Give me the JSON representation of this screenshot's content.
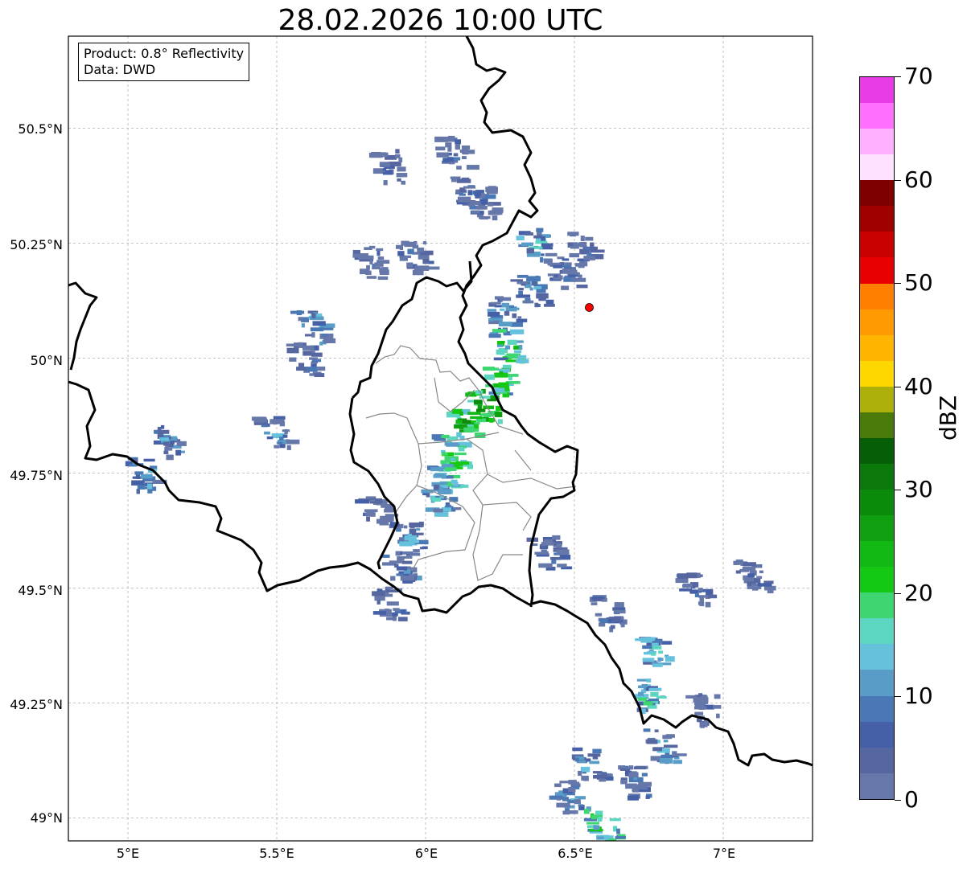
{
  "title": "28.02.2026 10:00 UTC",
  "info_box": {
    "product": "Product: 0.8° Reflectivity",
    "data": "Data: DWD"
  },
  "map": {
    "lon_range": [
      4.8,
      7.3
    ],
    "lat_range": [
      48.95,
      50.7
    ],
    "lon_ticks": [
      {
        "value": 5.0,
        "label": "5°E"
      },
      {
        "value": 5.5,
        "label": "5.5°E"
      },
      {
        "value": 6.0,
        "label": "6°E"
      },
      {
        "value": 6.5,
        "label": "6.5°E"
      },
      {
        "value": 7.0,
        "label": "7°E"
      }
    ],
    "lat_ticks": [
      {
        "value": 50.5,
        "label": "50.5°N"
      },
      {
        "value": 50.25,
        "label": "50.25°N"
      },
      {
        "value": 50.0,
        "label": "50°N"
      },
      {
        "value": 49.75,
        "label": "49.75°N"
      },
      {
        "value": 49.5,
        "label": "49.5°N"
      },
      {
        "value": 49.25,
        "label": "49.25°N"
      },
      {
        "value": 49.0,
        "label": "49°N"
      }
    ],
    "grid": true,
    "radar_site": {
      "lon": 6.55,
      "lat": 50.11,
      "color": "#ff0000"
    },
    "echo_cells": [
      {
        "lon": 6.1,
        "lat": 50.45,
        "dbz": 8
      },
      {
        "lon": 6.15,
        "lat": 50.36,
        "dbz": 9
      },
      {
        "lon": 5.82,
        "lat": 50.21,
        "dbz": 7
      },
      {
        "lon": 5.97,
        "lat": 50.22,
        "dbz": 7
      },
      {
        "lon": 5.88,
        "lat": 50.42,
        "dbz": 6
      },
      {
        "lon": 6.2,
        "lat": 50.34,
        "dbz": 8
      },
      {
        "lon": 5.63,
        "lat": 50.07,
        "dbz": 14
      },
      {
        "lon": 5.6,
        "lat": 50.0,
        "dbz": 9
      },
      {
        "lon": 5.5,
        "lat": 49.84,
        "dbz": 10
      },
      {
        "lon": 5.14,
        "lat": 49.82,
        "dbz": 11
      },
      {
        "lon": 5.06,
        "lat": 49.75,
        "dbz": 13
      },
      {
        "lon": 6.37,
        "lat": 50.25,
        "dbz": 15
      },
      {
        "lon": 6.36,
        "lat": 50.15,
        "dbz": 14
      },
      {
        "lon": 6.27,
        "lat": 50.1,
        "dbz": 13
      },
      {
        "lon": 6.28,
        "lat": 50.03,
        "dbz": 22
      },
      {
        "lon": 6.25,
        "lat": 49.96,
        "dbz": 24
      },
      {
        "lon": 6.2,
        "lat": 49.9,
        "dbz": 28
      },
      {
        "lon": 6.14,
        "lat": 49.86,
        "dbz": 26
      },
      {
        "lon": 6.1,
        "lat": 49.8,
        "dbz": 23
      },
      {
        "lon": 6.08,
        "lat": 49.74,
        "dbz": 20
      },
      {
        "lon": 6.05,
        "lat": 49.7,
        "dbz": 15
      },
      {
        "lon": 5.96,
        "lat": 49.61,
        "dbz": 12
      },
      {
        "lon": 5.92,
        "lat": 49.55,
        "dbz": 11
      },
      {
        "lon": 5.88,
        "lat": 49.47,
        "dbz": 9
      },
      {
        "lon": 5.84,
        "lat": 49.67,
        "dbz": 8
      },
      {
        "lon": 6.47,
        "lat": 50.19,
        "dbz": 8
      },
      {
        "lon": 6.53,
        "lat": 50.24,
        "dbz": 7
      },
      {
        "lon": 6.42,
        "lat": 49.58,
        "dbz": 9
      },
      {
        "lon": 6.62,
        "lat": 49.45,
        "dbz": 8
      },
      {
        "lon": 6.91,
        "lat": 49.5,
        "dbz": 7
      },
      {
        "lon": 7.1,
        "lat": 49.53,
        "dbz": 6
      },
      {
        "lon": 6.78,
        "lat": 49.36,
        "dbz": 16
      },
      {
        "lon": 6.75,
        "lat": 49.27,
        "dbz": 18
      },
      {
        "lon": 6.8,
        "lat": 49.16,
        "dbz": 13
      },
      {
        "lon": 6.55,
        "lat": 49.12,
        "dbz": 14
      },
      {
        "lon": 6.48,
        "lat": 49.05,
        "dbz": 12
      },
      {
        "lon": 6.6,
        "lat": 48.99,
        "dbz": 22
      },
      {
        "lon": 6.7,
        "lat": 49.08,
        "dbz": 11
      },
      {
        "lon": 6.95,
        "lat": 49.24,
        "dbz": 6
      }
    ]
  },
  "colorbar": {
    "label": "dBZ",
    "min": 0,
    "max": 70,
    "ticks": [
      "0",
      "10",
      "20",
      "30",
      "40",
      "50",
      "60",
      "70"
    ],
    "colors": [
      "#6677aa",
      "#5566a0",
      "#4560a6",
      "#4a78b4",
      "#5a9cc8",
      "#66c2dc",
      "#5cd6c0",
      "#3dd670",
      "#14c814",
      "#12b814",
      "#109f10",
      "#0c8a0c",
      "#0a780a",
      "#065e06",
      "#4a7a0a",
      "#aeb00a",
      "#ffd700",
      "#ffb400",
      "#ff9a00",
      "#ff7f00",
      "#e60000",
      "#c80000",
      "#a00000",
      "#7f0000",
      "#ffe0ff",
      "#ffb0ff",
      "#ff70ff",
      "#e83ce8"
    ]
  }
}
